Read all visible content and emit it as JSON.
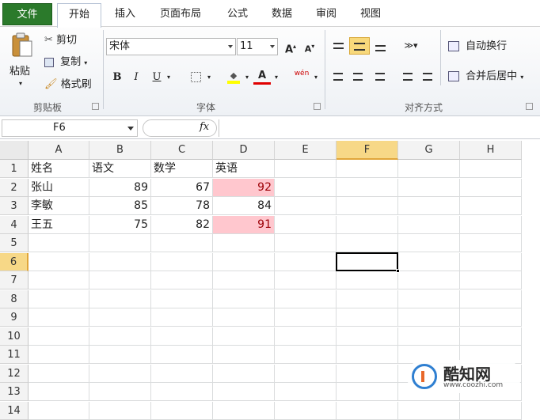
{
  "tabs": [
    "文件",
    "开始",
    "插入",
    "页面布局",
    "公式",
    "数据",
    "审阅",
    "视图"
  ],
  "ribbon": {
    "clipboard": {
      "paste": "粘贴",
      "cut": "剪切",
      "copy": "复制",
      "format_painter": "格式刷",
      "label": "剪贴板"
    },
    "font": {
      "family": "宋体",
      "size": "11",
      "label": "字体",
      "bold": "B",
      "italic": "I",
      "underline": "U",
      "grow": "A",
      "shrink": "A",
      "phonetic": "wén"
    },
    "alignment": {
      "wrap_text": "自动换行",
      "merge_center": "合并后居中",
      "label": "对齐方式"
    }
  },
  "formula_bar": {
    "name_box": "F6",
    "fx": "fx",
    "content": ""
  },
  "grid": {
    "columns": [
      "A",
      "B",
      "C",
      "D",
      "E",
      "F",
      "G",
      "H"
    ],
    "selected_column": "F",
    "rows": [
      "1",
      "2",
      "3",
      "4",
      "5",
      "6",
      "7",
      "8",
      "9",
      "10",
      "11",
      "12",
      "13",
      "14"
    ],
    "selected_row": "6",
    "cells": {
      "headers": [
        "姓名",
        "语文",
        "数学",
        "英语"
      ],
      "data": [
        {
          "name": "张山",
          "chinese": "89",
          "math": "67",
          "english": "92",
          "english_highlight": true
        },
        {
          "name": "李敏",
          "chinese": "85",
          "math": "78",
          "english": "84",
          "english_highlight": false
        },
        {
          "name": "王五",
          "chinese": "75",
          "math": "82",
          "english": "91",
          "english_highlight": true
        }
      ]
    },
    "highlight_color": "#ffc7ce",
    "highlight_text_color": "#9c0006"
  },
  "watermark": {
    "title": "酷知网",
    "url": "www.coozhi.com"
  }
}
